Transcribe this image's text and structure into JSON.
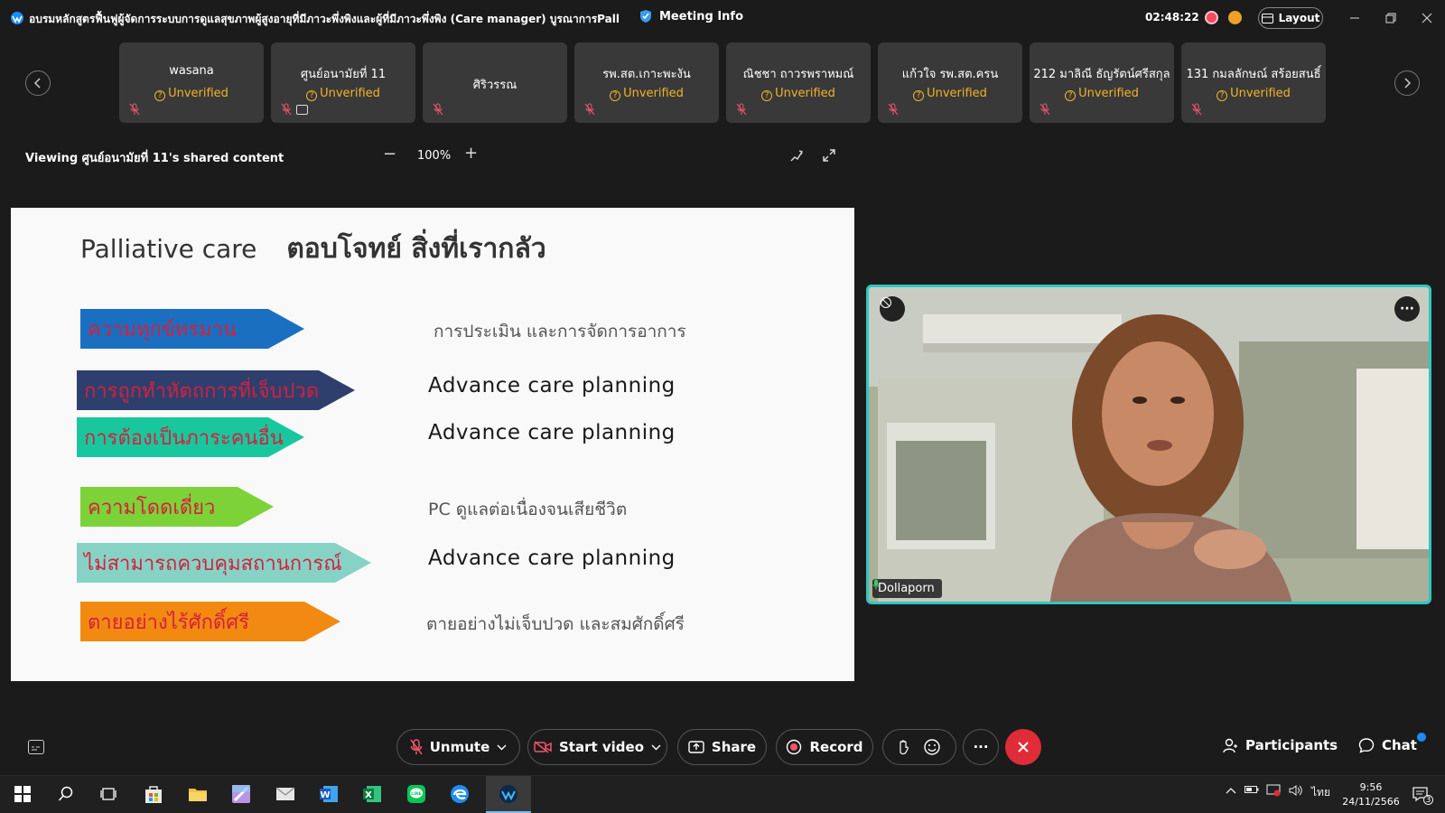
{
  "titlebar": {
    "app_title": "อบรมหลักสูตรฟื้นฟูผู้จัดการระบบการดูแลสุขภาพผู้สูงอายุที่มีภาวะพึ่งพิงและผู้ที่มีภาวะพึ่งพิง (Care manager) บูรณาการPalliative c",
    "meeting_info": "Meeting Info",
    "timer": "02:48:22",
    "layout_label": "Layout"
  },
  "participants": [
    {
      "name": "wasana",
      "status": "Unverified"
    },
    {
      "name": "ศูนย์อนามัยที่ 11",
      "status": "Unverified"
    },
    {
      "name": "ศิริวรรณ",
      "status": ""
    },
    {
      "name": "รพ.สต.เกาะพะงัน",
      "status": "Unverified"
    },
    {
      "name": "ณิชชา ถาวรพราหมณ์",
      "status": "Unverified"
    },
    {
      "name": "แก้วใจ รพ.สต.ครน",
      "status": "Unverified"
    },
    {
      "name": "212 มาลิณี ธัญรัตน์ศรีสกุล",
      "status": "Unverified"
    },
    {
      "name": "131 กมลลักษณ์ สร้อยสนธิ์",
      "status": "Unverified"
    }
  ],
  "viewing": {
    "label": "Viewing ศูนย์อนามัยที่ 11's shared content",
    "zoom": "100%"
  },
  "slide": {
    "title_en": "Palliative care",
    "title_th": "ตอบโจทย์ สิ่งที่เรากลัว",
    "rows": [
      {
        "label": "ความทุกข์ทรมาน",
        "desc": "การประเมิน และการจัดการอาการ",
        "color": "#1a6fc0"
      },
      {
        "label": "การถูกทำหัตถการที่เจ็บปวด",
        "desc": "Advance care  planning",
        "color": "#2e3f6e"
      },
      {
        "label": "การต้องเป็นภาระคนอื่น",
        "desc": "Advance care  planning",
        "color": "#19c79e"
      },
      {
        "label": "ความโดดเดี่ยว",
        "desc": "PC ดูแลต่อเนื่องจนเสียชีวิต",
        "color": "#7cd237"
      },
      {
        "label": "ไม่สามารถควบคุมสถานการณ์",
        "desc": "Advance care  planning",
        "color": "#86d3c6"
      },
      {
        "label": "ตายอย่างไร้ศักดิ์ศรี",
        "desc": "ตายอย่างไม่เจ็บปวด และสมศักดิ์ศรี",
        "color": "#f28a12"
      }
    ]
  },
  "video": {
    "name": "Dollaporn"
  },
  "controls": {
    "unmute": "Unmute",
    "start_video": "Start video",
    "share": "Share",
    "record": "Record",
    "participants": "Participants",
    "chat": "Chat"
  },
  "taskbar": {
    "time": "9:56",
    "date": "24/11/2566",
    "lang": "ไทย",
    "notif_count": "3"
  },
  "colors": {
    "accent_teal": "#2ec8c0",
    "unverified": "#f0b42a",
    "end_call": "#e02b38"
  }
}
